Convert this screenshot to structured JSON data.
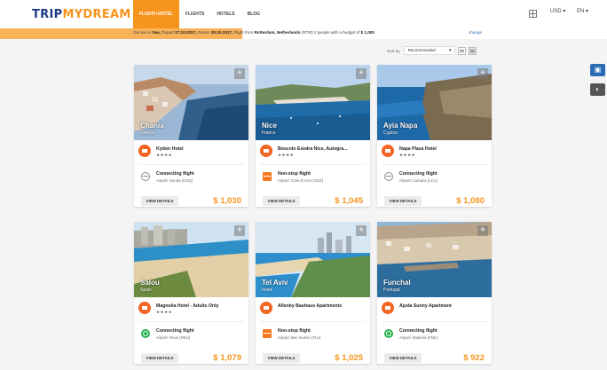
{
  "logo": {
    "part1": "TRIP",
    "part2": "MYDREAM"
  },
  "nav": [
    {
      "label": "FLIGHT+HOTEL"
    },
    {
      "label": "FLIGHTS"
    },
    {
      "label": "HOTELS"
    },
    {
      "label": "BLOG"
    }
  ],
  "header_tools": {
    "currency": "USD ▾",
    "language": "EN ▾"
  },
  "summary": {
    "get_label": "Get me to",
    "destination": "Sea,",
    "depart_label": "Depart",
    "depart": "27.10.2017,",
    "return_label": "Return",
    "return": "30.10.2017,",
    "flight_label": "Flight from",
    "origin": "Rotterdam, Netherlands",
    "origin_code": "(RTM)",
    "people": "2 people with a budget of",
    "budget": "$ 1,000",
    "change": "change"
  },
  "sort": {
    "label": "Sort by",
    "value": "Recommended"
  },
  "colors": {
    "accent": "#f7941d",
    "brand_blue": "#1f3c88",
    "side_blue": "#2a6db5"
  },
  "side_buttons": [
    {
      "icon": "hotel-icon"
    },
    {
      "icon": "chat-icon"
    }
  ],
  "cards": [
    {
      "city": "Chania",
      "country": "Greece",
      "hotel": "Kydon Hotel",
      "stars": "★★★★",
      "flight_type": "Connecting flight",
      "flight_icon": "connecting-flight-icon",
      "airport": "Airport: Souda (CHQ)",
      "button": "VIEW DETAILS",
      "price": "$ 1,030"
    },
    {
      "city": "Nice",
      "country": "France",
      "hotel": "Boscolo Exedra Nice, Autogra...",
      "stars": "★★★★",
      "flight_type": "Non-stop flight",
      "flight_icon": "nonstop-flight-icon",
      "airport": "Airport: Cote D'Azur (NCE)",
      "button": "VIEW DETAILS",
      "price": "$ 1,045"
    },
    {
      "city": "Ayia Napa",
      "country": "Cyprus",
      "hotel": "Napa Plaza Hotel",
      "stars": "★★★★",
      "flight_type": "Connecting flight",
      "flight_icon": "connecting-flight-icon",
      "airport": "Airport: Larnaca (LCA)",
      "button": "VIEW DETAILS",
      "price": "$ 1,080"
    },
    {
      "city": "Salou",
      "country": "Spain",
      "hotel": "Magnolia Hotel - Adults Only",
      "stars": "★★★★",
      "flight_type": "Connecting flight",
      "flight_icon": "green-flight-icon",
      "airport": "Airport: Reus (REU)",
      "button": "VIEW DETAILS",
      "price": "$ 1,079"
    },
    {
      "city": "Tel Aviv",
      "country": "Israel",
      "hotel": "Allenby Bauhaus Apartments",
      "stars": "",
      "flight_type": "Non-stop flight",
      "flight_icon": "nonstop-flight-icon",
      "airport": "Airport: Ben Gurion (TLV)",
      "button": "VIEW DETAILS",
      "price": "$ 1,025"
    },
    {
      "city": "Funchal",
      "country": "Portugal",
      "hotel": "Ajuda Sunny Apartment",
      "stars": "",
      "flight_type": "Connecting flight",
      "flight_icon": "green-flight-icon",
      "airport": "Airport: Madeira (FNC)",
      "button": "VIEW DETAILS",
      "price": "$ 922"
    }
  ]
}
